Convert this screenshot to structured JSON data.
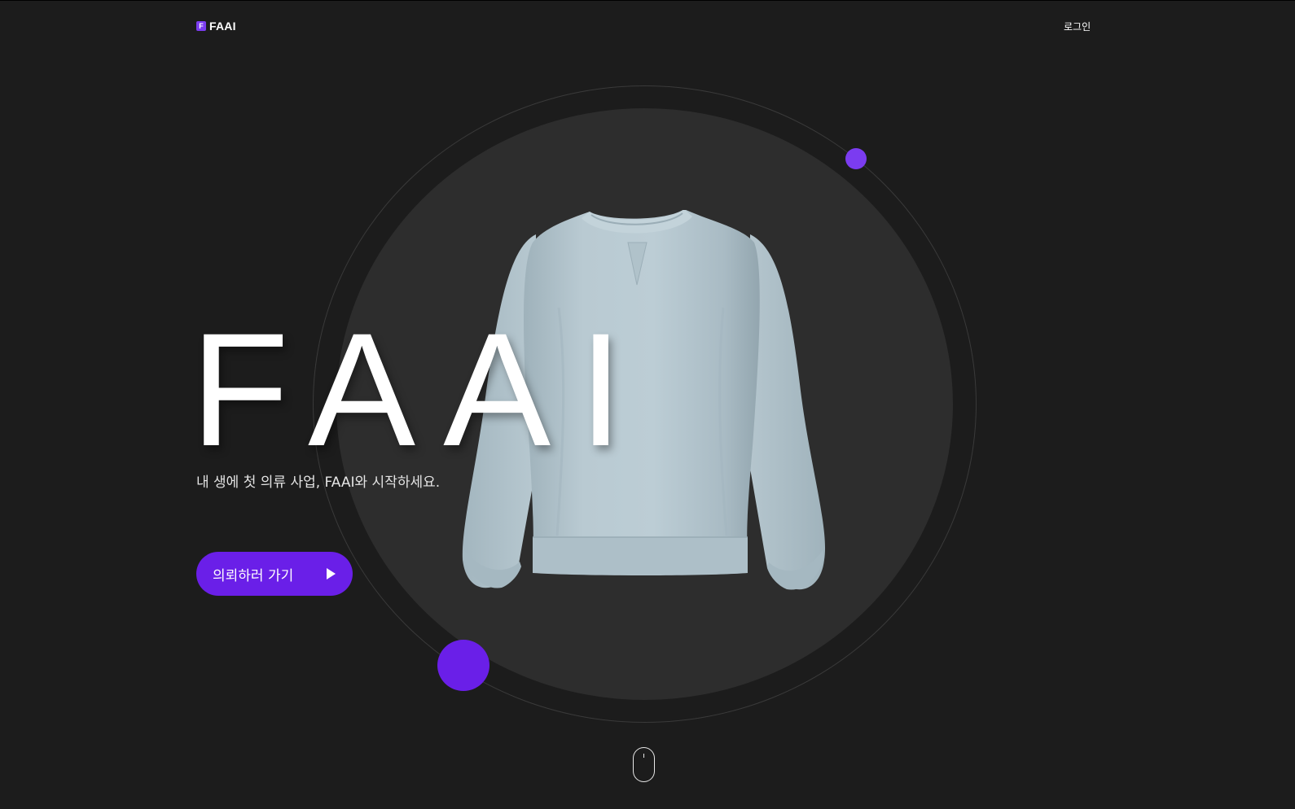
{
  "header": {
    "logo_mark": "F",
    "logo_text": "FAAI",
    "login_label": "로그인"
  },
  "hero": {
    "title": "FAAI",
    "subtitle": "내 생에 첫 의류 사업, FAAI와 시작하세요.",
    "cta_label": "의뢰하러 가기",
    "cta_icon": "play-triangle-icon"
  },
  "product": {
    "image": "sweatshirt-image"
  },
  "scroll": {
    "icon": "mouse-scroll-icon"
  },
  "colors": {
    "background": "#1c1c1c",
    "circle": "#2d2d2d",
    "accent": "#6a1fe8",
    "accent_light": "#7b3cf0",
    "sweatshirt": "#b7c8d0"
  }
}
